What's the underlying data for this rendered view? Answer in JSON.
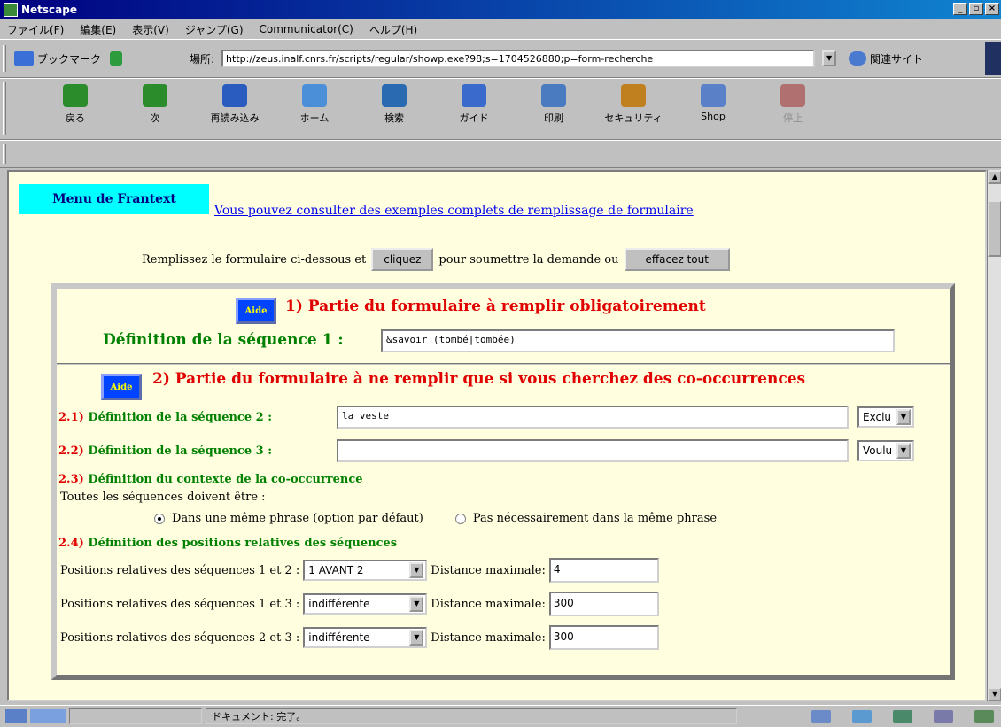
{
  "window": {
    "title": "Netscape",
    "minimize": "_",
    "maximize": "▫",
    "close": "×"
  },
  "menu": [
    "ファイル(F)",
    "編集(E)",
    "表示(V)",
    "ジャンプ(G)",
    "Communicator(C)",
    "ヘルプ(H)"
  ],
  "location": {
    "bookmarks_label": "ブックマーク",
    "location_label": "場所:",
    "url": "http://zeus.inalf.cnrs.fr/scripts/regular/showp.exe?98;s=1704526880;p=form-recherche",
    "related_label": "関連サイト"
  },
  "toolbar": {
    "buttons": [
      {
        "label": "戻る",
        "color": "#2a8c2a"
      },
      {
        "label": "次",
        "color": "#2a8c2a"
      },
      {
        "label": "再読み込み",
        "color": "#2a5cc0"
      },
      {
        "label": "ホーム",
        "color": "#4b8fd8"
      },
      {
        "label": "検索",
        "color": "#2a6ab0"
      },
      {
        "label": "ガイド",
        "color": "#3a6acb"
      },
      {
        "label": "印刷",
        "color": "#4a7ac0"
      },
      {
        "label": "セキュリティ",
        "color": "#c08020"
      },
      {
        "label": "Shop",
        "color": "#5a80c8"
      },
      {
        "label": "停止",
        "color": "#b07070"
      }
    ]
  },
  "page": {
    "menu_frantext": "Menu de Frantext",
    "examples_link": "Vous pouvez consulter des exemples complets de remplissage de formulaire",
    "submit_before": "Remplissez le formulaire ci-dessous et",
    "submit_button": "cliquez",
    "submit_middle": "pour soumettre la demande ou",
    "clear_button": "effacez tout",
    "aide": "Aide",
    "part1_title": "1) Partie du formulaire à remplir obligatoirement",
    "seq1_label": "Définition de la séquence 1 :",
    "seq1_value": "&savoir (tombé|tombée)",
    "part2_title": "2) Partie du formulaire à ne remplir que si vous cherchez des co-occurrences",
    "seq2_num": "2.1)",
    "seq2_label": "Définition de la séquence 2 :",
    "seq2_value": "la veste",
    "seq2_mode": "Exclu",
    "seq3_num": "2.2)",
    "seq3_label": "Définition de la séquence 3 :",
    "seq3_value": "",
    "seq3_mode": "Voulu",
    "ctx_num": "2.3)",
    "ctx_label": "Définition du contexte de la co-occurrence",
    "ctx_text": "Toutes les séquences doivent être :",
    "radio1": "Dans une même phrase (option par défaut)",
    "radio2": "Pas nécessairement dans la même phrase",
    "pos_num": "2.4)",
    "pos_label": "Définition des positions relatives des séquences",
    "pos_rows": [
      {
        "label": "Positions relatives des séquences 1 et 2 :",
        "select": "1 AVANT 2",
        "dist_label": "Distance maximale:",
        "dist": "4"
      },
      {
        "label": "Positions relatives des séquences 1 et 3 :",
        "select": "indifférente",
        "dist_label": "Distance maximale:",
        "dist": "300"
      },
      {
        "label": "Positions relatives des séquences 2 et 3 :",
        "select": "indifférente",
        "dist_label": "Distance maximale:",
        "dist": "300"
      }
    ]
  },
  "status": {
    "text": "ドキュメント: 完了。"
  }
}
